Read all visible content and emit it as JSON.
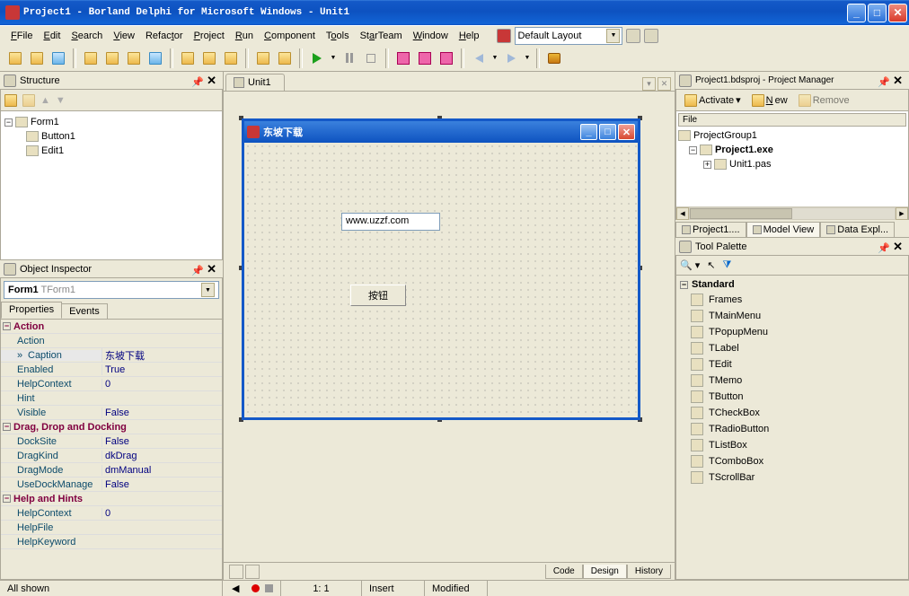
{
  "title": "Project1 - Borland Delphi for Microsoft Windows - Unit1",
  "menu": [
    "File",
    "Edit",
    "Search",
    "View",
    "Refactor",
    "Project",
    "Run",
    "Component",
    "Tools",
    "StarTeam",
    "Window",
    "Help"
  ],
  "layout_label": "Default Layout",
  "structure": {
    "title": "Structure",
    "root": "Form1",
    "children": [
      "Button1",
      "Edit1"
    ]
  },
  "object_inspector": {
    "title": "Object Inspector",
    "component": "Form1",
    "component_type": "TForm1",
    "tabs": [
      "Properties",
      "Events"
    ],
    "rows": [
      {
        "cat": "Action"
      },
      {
        "n": "Action",
        "v": ""
      },
      {
        "n": "Caption",
        "v": "东坡下载",
        "sel": true
      },
      {
        "n": "Enabled",
        "v": "True"
      },
      {
        "n": "HelpContext",
        "v": "0"
      },
      {
        "n": "Hint",
        "v": ""
      },
      {
        "n": "Visible",
        "v": "False"
      },
      {
        "cat": "Drag, Drop and Docking"
      },
      {
        "n": "DockSite",
        "v": "False"
      },
      {
        "n": "DragKind",
        "v": "dkDrag"
      },
      {
        "n": "DragMode",
        "v": "dmManual"
      },
      {
        "n": "UseDockManage",
        "v": "False"
      },
      {
        "cat": "Help and Hints"
      },
      {
        "n": "HelpContext",
        "v": "0"
      },
      {
        "n": "HelpFile",
        "v": ""
      },
      {
        "n": "HelpKeyword",
        "v": ""
      }
    ],
    "footer": "All shown"
  },
  "center": {
    "tab": "Unit1",
    "form_title": "东坡下载",
    "edit_value": "www.uzzf.com",
    "button_caption": "按钮",
    "bottom_tabs": [
      "Code",
      "Design",
      "History"
    ],
    "status": {
      "pos": "1: 1",
      "mode": "Insert",
      "state": "Modified"
    }
  },
  "project_manager": {
    "title": "Project1.bdsproj - Project Manager",
    "activate": "Activate",
    "new": "New",
    "remove": "Remove",
    "header": "File",
    "root": "ProjectGroup1",
    "project": "Project1.exe",
    "unit": "Unit1.pas",
    "tabs": [
      "Project1....",
      "Model View",
      "Data Expl..."
    ]
  },
  "tool_palette": {
    "title": "Tool Palette",
    "category": "Standard",
    "items": [
      "Frames",
      "TMainMenu",
      "TPopupMenu",
      "TLabel",
      "TEdit",
      "TMemo",
      "TButton",
      "TCheckBox",
      "TRadioButton",
      "TListBox",
      "TComboBox",
      "TScrollBar"
    ]
  }
}
